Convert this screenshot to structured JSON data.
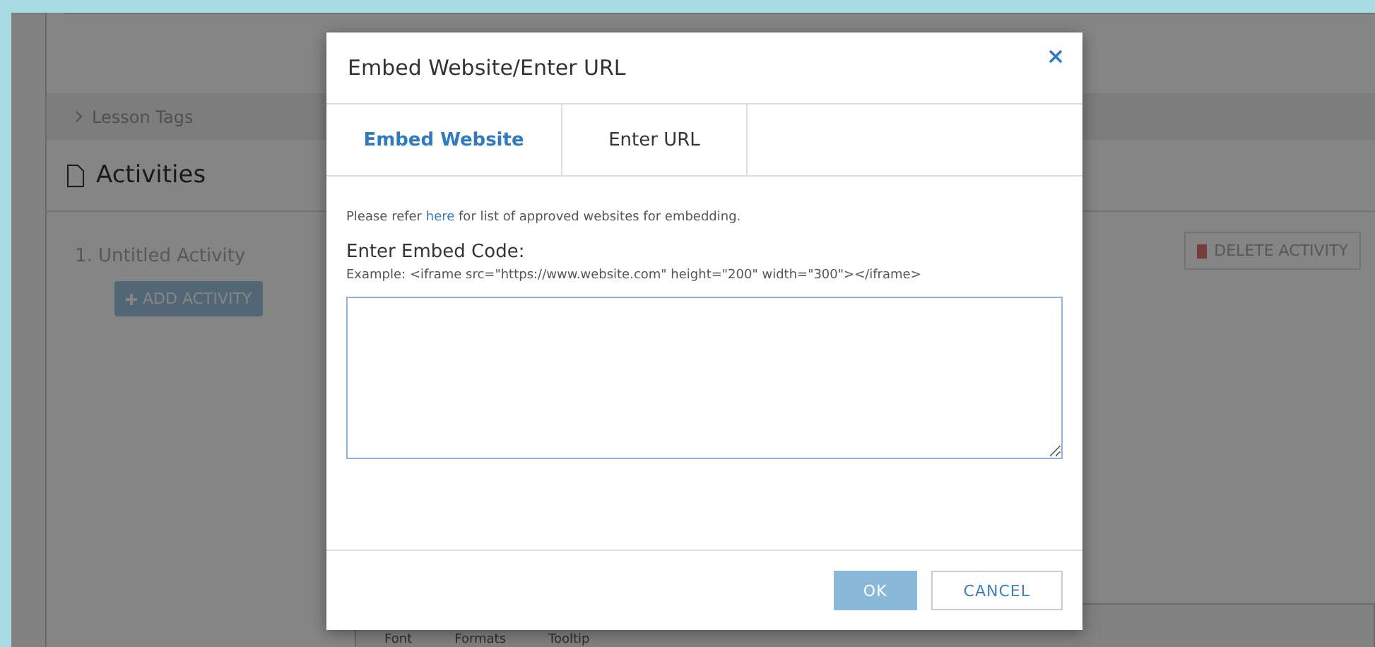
{
  "background": {
    "section_toggle": "Lesson Tags",
    "section_title": "Activities",
    "activities": [
      {
        "title": "1. Untitled Activity"
      }
    ],
    "delete_button": "DELETE ACTIVITY",
    "add_button": "ADD ACTIVITY",
    "editor_toolbar": [
      "Font",
      "Formats",
      "Tooltip"
    ]
  },
  "dialog": {
    "title": "Embed Website/Enter URL",
    "tabs": [
      {
        "label": "Embed Website",
        "selected": true
      },
      {
        "label": "Enter URL",
        "selected": false
      }
    ],
    "note_before": "Please refer ",
    "note_link": "here",
    "note_after": " for list of approved websites for embedding.",
    "field_label": "Enter Embed Code:",
    "example": "Example: <iframe src=\"https://www.website.com\" height=\"200\" width=\"300\"></iframe>",
    "buttons": [
      {
        "label": "OK",
        "kind": "primary"
      },
      {
        "label": "CANCEL",
        "kind": "secondary"
      }
    ]
  }
}
